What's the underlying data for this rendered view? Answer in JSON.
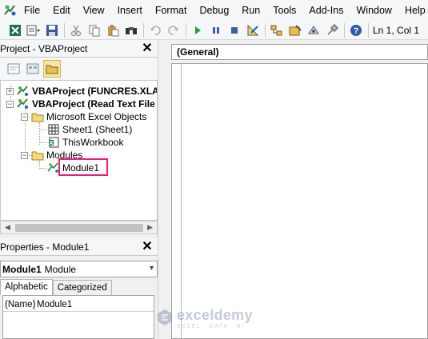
{
  "menubar": {
    "items": [
      {
        "label": "File"
      },
      {
        "label": "Edit"
      },
      {
        "label": "View"
      },
      {
        "label": "Insert"
      },
      {
        "label": "Format"
      },
      {
        "label": "Debug"
      },
      {
        "label": "Run"
      },
      {
        "label": "Tools"
      },
      {
        "label": "Add-Ins"
      },
      {
        "label": "Window"
      },
      {
        "label": "Help"
      }
    ]
  },
  "toolbar": {
    "status": "Ln 1, Col 1",
    "icons": [
      "view-excel-icon",
      "insert-module-icon",
      "save-icon",
      "cut-icon",
      "copy-icon",
      "paste-icon",
      "find-icon",
      "undo-icon",
      "redo-icon",
      "run-icon",
      "break-icon",
      "reset-icon",
      "design-mode-icon",
      "project-explorer-icon",
      "properties-icon",
      "object-browser-icon",
      "toolbox-icon",
      "help-icon"
    ]
  },
  "project_panel": {
    "title": "Project - VBAProject",
    "tree": [
      {
        "label": "VBAProject (FUNCRES.XLAM",
        "bold": true
      },
      {
        "label": "VBAProject (Read Text File",
        "bold": true
      },
      {
        "label": "Microsoft Excel Objects",
        "bold": false
      },
      {
        "label": "Sheet1 (Sheet1)",
        "bold": false
      },
      {
        "label": "ThisWorkbook",
        "bold": false
      },
      {
        "label": "Modules",
        "bold": false
      },
      {
        "label": "Module1",
        "bold": false
      }
    ],
    "selected": "Module1"
  },
  "properties_panel": {
    "title": "Properties - Module1",
    "object_name": "Module1",
    "object_type": "Module",
    "tabs": [
      {
        "label": "Alphabetic",
        "selected": true
      },
      {
        "label": "Categorized",
        "selected": false
      }
    ],
    "rows": [
      {
        "key": "(Name)",
        "value": "Module1"
      }
    ]
  },
  "code_window": {
    "object_combo": "(General)"
  },
  "watermark": {
    "name": "exceldemy",
    "tagline": "EXCEL · DATA · BI"
  },
  "colors": {
    "highlight": "#e8217a",
    "accent_green": "#2e9b3b",
    "folder_yellow": "#e8c050"
  }
}
